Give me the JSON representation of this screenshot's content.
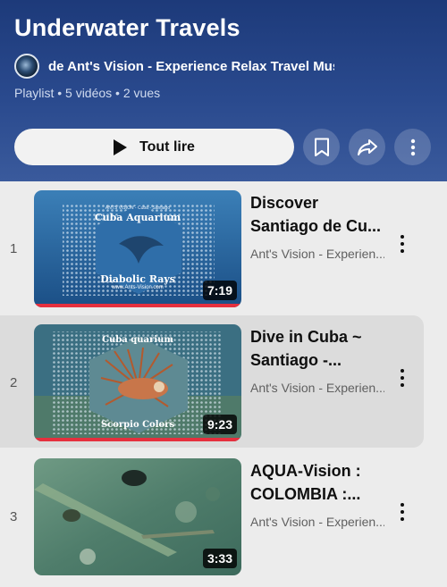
{
  "playlist": {
    "title": "Underwater Travels",
    "owner": "de Ant's Vision - Experience Relax Travel Music Trip",
    "meta": "Playlist • 5 vidéos • 2 vues",
    "play_all_label": "Tout lire"
  },
  "icons": {
    "save": "bookmark-icon",
    "share": "share-icon",
    "more": "more-vert-icon",
    "play": "play-icon"
  },
  "colors": {
    "header_top": "#1d3a7a",
    "progress": "#e5303e",
    "list_bg": "#ececec"
  },
  "videos": [
    {
      "index": "1",
      "title_line1": "Discover",
      "title_line2": "Santiago de Cu...",
      "channel": "Ant's Vision - Experien...",
      "duration": "7:19",
      "thumb_top": "Cuba Aquarium",
      "thumb_bottom": "Diabolic Rays",
      "thumb_sub": "www.Ants-Vision.com",
      "thumb_tiny": "ANTS VISION - Cuba - Santiago",
      "progress": 1.0
    },
    {
      "index": "2",
      "title_line1": "Dive in Cuba ~",
      "title_line2": "Santiago -...",
      "channel": "Ant's Vision - Experien...",
      "duration": "9:23",
      "thumb_top": "Cuba quarium",
      "thumb_bottom": "Scorpio Colors",
      "progress": 1.0
    },
    {
      "index": "3",
      "title_line1": "AQUA-Vision :",
      "title_line2": "COLOMBIA :...",
      "channel": "Ant's Vision - Experien...",
      "duration": "3:33",
      "progress": 0
    }
  ]
}
